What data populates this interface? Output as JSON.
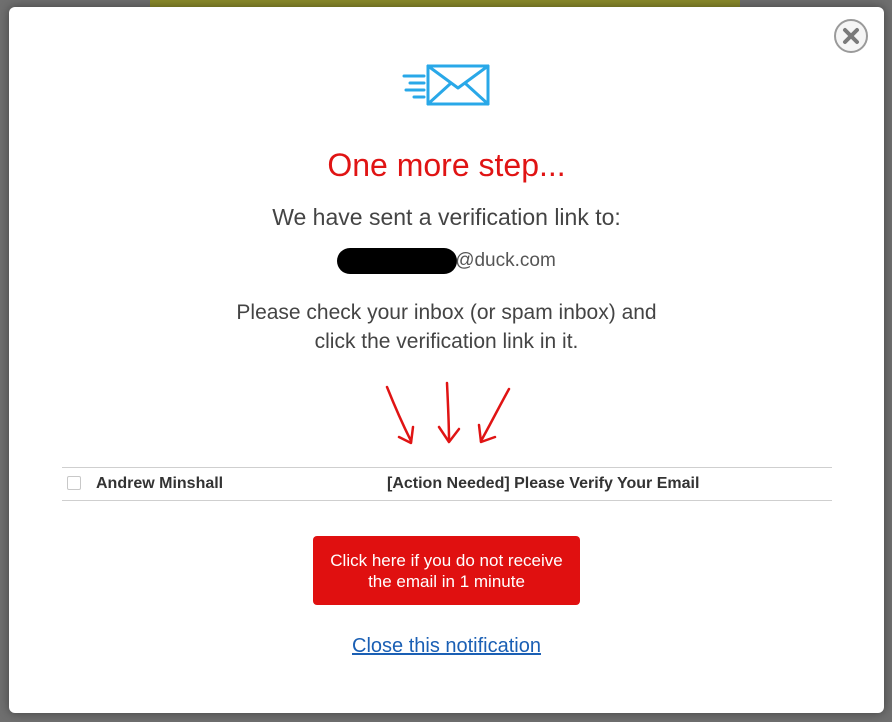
{
  "modal": {
    "close_icon": "close-x-icon",
    "mail_icon": "flying-envelope-icon",
    "title": "One more step...",
    "sent_text": "We have sent a verification link to:",
    "email_domain": "@duck.com",
    "instructions_line1": "Please check your inbox (or spam inbox) and",
    "instructions_line2": "click the verification link in it.",
    "arrows_icon": "down-arrows-icon",
    "inbox_preview": {
      "sender": "Andrew Minshall",
      "subject": "[Action Needed] Please Verify Your Email"
    },
    "resend_button": "Click here if you do not receive the email in 1 minute",
    "close_link": "Close this notification"
  },
  "colors": {
    "title": "#e01414",
    "button": "#e01010",
    "link": "#1a5fb4",
    "mail_icon": "#29a8e8"
  }
}
